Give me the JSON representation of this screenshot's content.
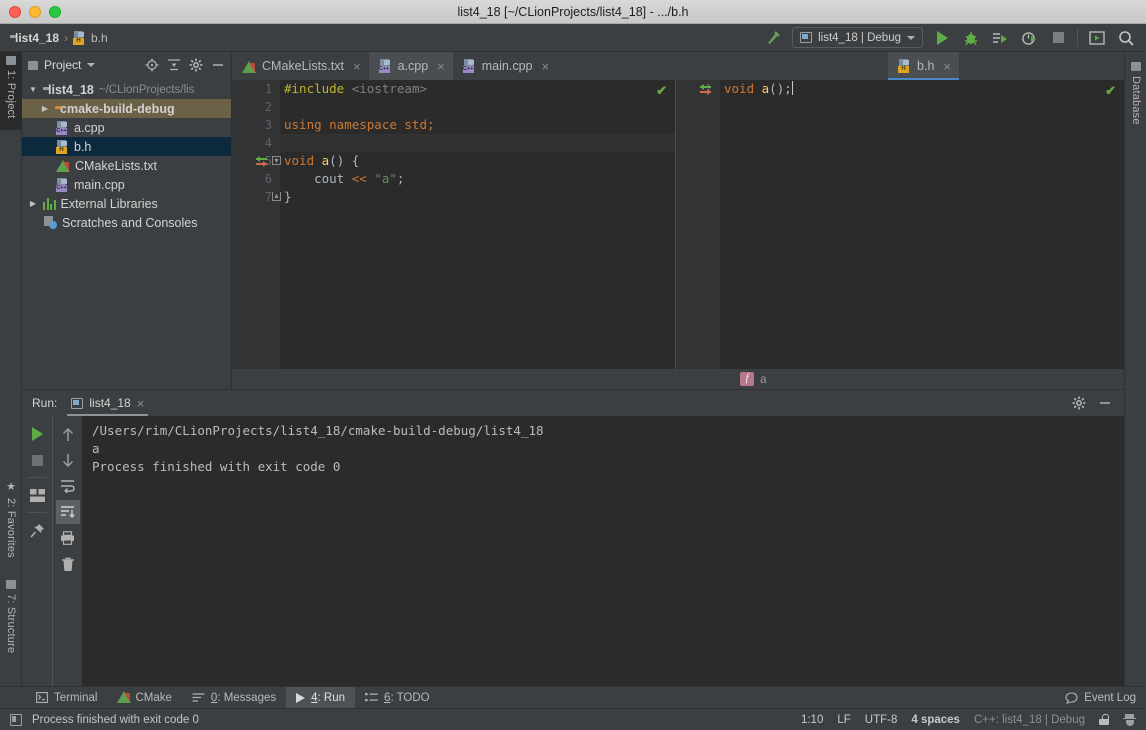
{
  "window": {
    "title": "list4_18 [~/CLionProjects/list4_18] - .../b.h",
    "traffic_lights": [
      "close-button",
      "minimize-button",
      "zoom-button"
    ]
  },
  "navbar": {
    "breadcrumb": [
      {
        "label": "list4_18",
        "icon": "folder-icon"
      },
      {
        "label": "b.h",
        "icon": "h-file-icon"
      }
    ],
    "separator": "›",
    "build_icon": "build-hammer-icon",
    "run_config": {
      "label": "list4_18 | Debug",
      "icon": "run-config-icon",
      "caret": "chevron-down-icon"
    },
    "actions": [
      {
        "name": "run-button",
        "icon": "run-icon"
      },
      {
        "name": "debug-button",
        "icon": "debug-bug-icon"
      },
      {
        "name": "run-with-coverage-button",
        "icon": "coverage-icon"
      },
      {
        "name": "profile-button",
        "icon": "profiler-icon"
      },
      {
        "name": "stop-button",
        "icon": "stop-icon"
      },
      {
        "name": "preview-button",
        "icon": "preview-icon"
      },
      {
        "name": "search-everywhere-button",
        "icon": "search-icon"
      }
    ]
  },
  "left_strip": {
    "tabs": [
      {
        "label": "1: Project",
        "mnemonic": "1",
        "selected": true
      },
      {
        "label": "2: Favorites",
        "mnemonic": "2",
        "selected": false
      },
      {
        "label": "7: Structure",
        "mnemonic": "7",
        "selected": false
      }
    ]
  },
  "right_strip": {
    "tabs": [
      {
        "label": "Database",
        "icon": "database-icon"
      }
    ]
  },
  "project_panel": {
    "title": "Project",
    "caret": "chevron-down-icon",
    "header_icons": [
      "locate-icon",
      "collapse-all-icon",
      "settings-gear-icon",
      "hide-icon"
    ],
    "tree": [
      {
        "label": "list4_18",
        "sub": "~/CLionProjects/lis",
        "icon": "folder-icon",
        "arrow": "▼",
        "indent": 0,
        "state": ""
      },
      {
        "label": "cmake-build-debug",
        "sub": "",
        "icon": "folder-orange-icon",
        "arrow": "▶",
        "indent": 1,
        "state": "hover"
      },
      {
        "label": "a.cpp",
        "sub": "",
        "icon": "cpp-file-icon",
        "arrow": "",
        "indent": 2,
        "state": ""
      },
      {
        "label": "b.h",
        "sub": "",
        "icon": "h-file-icon",
        "arrow": "",
        "indent": 2,
        "state": "sel"
      },
      {
        "label": "CMakeLists.txt",
        "sub": "",
        "icon": "cmake-file-icon",
        "arrow": "",
        "indent": 2,
        "state": ""
      },
      {
        "label": "main.cpp",
        "sub": "",
        "icon": "cpp-file-icon",
        "arrow": "",
        "indent": 2,
        "state": ""
      },
      {
        "label": "External Libraries",
        "sub": "",
        "icon": "libraries-icon",
        "arrow": "▶",
        "indent": 0,
        "state": ""
      },
      {
        "label": "Scratches and Consoles",
        "sub": "",
        "icon": "scratches-icon",
        "arrow": "",
        "indent": 0,
        "state": ""
      }
    ]
  },
  "editor": {
    "tabs": [
      {
        "label": "CMakeLists.txt",
        "icon": "cmake-file-icon",
        "state": ""
      },
      {
        "label": "a.cpp",
        "icon": "cpp-file-icon",
        "state": "soft"
      },
      {
        "label": "main.cpp",
        "icon": "cpp-file-icon",
        "state": ""
      },
      {
        "label": "b.h",
        "icon": "h-file-icon",
        "state": "active-split"
      }
    ],
    "close_glyph": "×",
    "left_pane": {
      "file": "a.cpp",
      "line_numbers": [
        "1",
        "2",
        "3",
        "4",
        "5",
        "6",
        "7"
      ],
      "current_line": 4,
      "inspection_status": "ok-check",
      "lines": [
        {
          "n": 1,
          "tokens": [
            {
              "t": "#include ",
              "c": "k-hash"
            },
            {
              "t": "<iostream>",
              "c": "k-grey"
            }
          ]
        },
        {
          "n": 2,
          "tokens": []
        },
        {
          "n": 3,
          "tokens": [
            {
              "t": "using namespace ",
              "c": "k-orange"
            },
            {
              "t": "std",
              "c": "k-orange"
            },
            {
              "t": ";",
              "c": "k-orange"
            }
          ]
        },
        {
          "n": 4,
          "tokens": []
        },
        {
          "n": 5,
          "tokens": [
            {
              "t": "void ",
              "c": "k-orange"
            },
            {
              "t": "a",
              "c": "k-yellow"
            },
            {
              "t": "() {",
              "c": "k-white"
            }
          ]
        },
        {
          "n": 6,
          "tokens": [
            {
              "t": "    cout ",
              "c": "k-white"
            },
            {
              "t": "<< ",
              "c": "k-orange"
            },
            {
              "t": "\"a\"",
              "c": "k-green"
            },
            {
              "t": ";",
              "c": "k-white"
            }
          ]
        },
        {
          "n": 7,
          "tokens": [
            {
              "t": "}",
              "c": "k-white"
            }
          ]
        }
      ]
    },
    "right_pane": {
      "file": "b.h",
      "line_numbers": [
        "1"
      ],
      "inspection_status": "ok-check",
      "lines": [
        {
          "n": 1,
          "tokens": [
            {
              "t": "void ",
              "c": "k-orange"
            },
            {
              "t": "a",
              "c": "k-yellow"
            },
            {
              "t": "();",
              "c": "k-white"
            }
          ]
        }
      ]
    },
    "breadcrumb": {
      "badge": "f",
      "label": "a"
    }
  },
  "run_panel": {
    "label": "Run:",
    "tab": {
      "label": "list4_18",
      "icon": "run-config-icon",
      "close": "×"
    },
    "header_actions": [
      {
        "name": "run-settings-button",
        "icon": "settings-gear-icon"
      },
      {
        "name": "hide-panel-button",
        "icon": "hide-icon"
      }
    ],
    "left_tools": [
      {
        "name": "rerun-button",
        "icon": "run-icon",
        "active": false
      },
      {
        "name": "stop-process-button",
        "icon": "stop-icon",
        "active": false
      },
      {
        "name": "layout-settings-button",
        "icon": "layout-icon",
        "active": false
      },
      {
        "name": "pin-tab-button",
        "icon": "pin-icon",
        "active": false
      }
    ],
    "right_tools": [
      {
        "name": "up-occurrence-button",
        "icon": "arrow-up-icon",
        "active": false
      },
      {
        "name": "down-occurrence-button",
        "icon": "arrow-down-icon",
        "active": false
      },
      {
        "name": "soft-wrap-button",
        "icon": "soft-wrap-icon",
        "active": false
      },
      {
        "name": "scroll-to-end-button",
        "icon": "scroll-to-end-icon",
        "active": true
      },
      {
        "name": "print-button",
        "icon": "print-icon",
        "active": false
      },
      {
        "name": "clear-all-button",
        "icon": "trash-icon",
        "active": false
      }
    ],
    "console": [
      "/Users/rim/CLionProjects/list4_18/cmake-build-debug/list4_18",
      "a",
      "Process finished with exit code 0"
    ]
  },
  "bottom_bar": {
    "tabs": [
      {
        "label": "Terminal",
        "mnemonic": "",
        "icon": "terminal-icon",
        "selected": false
      },
      {
        "label": "CMake",
        "mnemonic": "",
        "icon": "cmake-file-icon",
        "selected": false
      },
      {
        "label": "0: Messages",
        "mnemonic": "0",
        "icon": "messages-icon",
        "selected": false
      },
      {
        "label": "4: Run",
        "mnemonic": "4",
        "icon": "run-icon",
        "selected": true
      },
      {
        "label": "6: TODO",
        "mnemonic": "6",
        "icon": "todo-icon",
        "selected": false
      }
    ],
    "event_log": {
      "label": "Event Log",
      "icon": "event-log-icon"
    }
  },
  "status_bar": {
    "icon": "toggle-sidebar-icon",
    "message": "Process finished with exit code 0",
    "caret_position": "1:10",
    "line_separator": "LF",
    "encoding": "UTF-8",
    "indent": "4 spaces",
    "toolchain": "C++: list4_18 | Debug",
    "lock_icon": "unlocked-icon",
    "inspection_icon": "hector-inspection-icon"
  },
  "colors": {
    "chrome": "#3c3f41",
    "editor_bg": "#2b2b2b",
    "gutter_bg": "#313335",
    "selection": "#0d293e",
    "hover": "#6b6147",
    "accent_blue": "#4a88c7",
    "accent_green": "#5fad46"
  }
}
